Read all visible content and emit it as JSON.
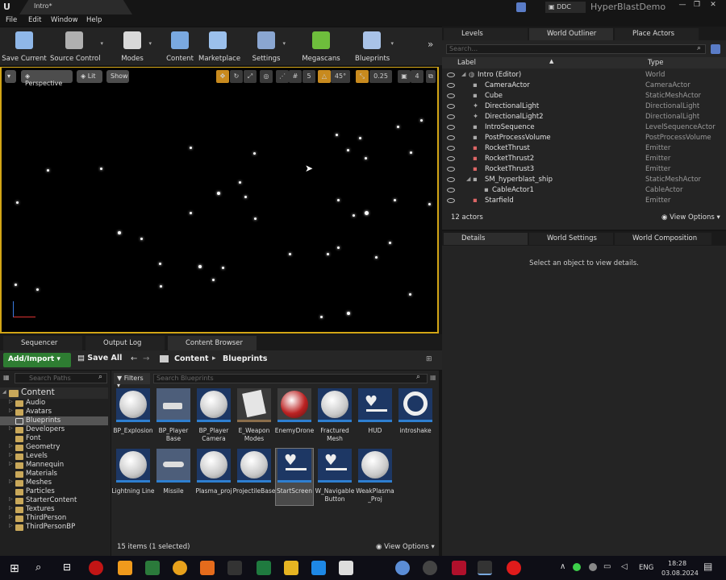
{
  "titlebar": {
    "tab": "Intro*",
    "ddc": "DDC",
    "project": "HyperBlastDemo"
  },
  "menu": [
    "File",
    "Edit",
    "Window",
    "Help"
  ],
  "toolbar": [
    {
      "label": "Save Current",
      "icon": "save-icon",
      "color": "#8fb7e8"
    },
    {
      "label": "Source Control",
      "icon": "source-control-icon",
      "color": "#b0b0b0"
    },
    {
      "label": "Modes",
      "icon": "modes-icon",
      "color": "#d9d9d9"
    },
    {
      "label": "Content",
      "icon": "content-icon",
      "color": "#7aa9e0"
    },
    {
      "label": "Marketplace",
      "icon": "marketplace-icon",
      "color": "#9bc0ec"
    },
    {
      "label": "Settings",
      "icon": "settings-icon",
      "color": "#8aa6d1"
    },
    {
      "label": "Megascans",
      "icon": "megascans-icon",
      "color": "#6ebe3c"
    },
    {
      "label": "Blueprints",
      "icon": "blueprints-icon",
      "color": "#a9c3e8"
    }
  ],
  "viewport": {
    "perspective": "Perspective",
    "lit": "Lit",
    "show": "Show",
    "grid_value": "5",
    "angle_value": "45°",
    "scale_value": "0.25",
    "speed_value": "4"
  },
  "bottom_tabs": [
    "Sequencer",
    "Output Log",
    "Content Browser"
  ],
  "content_browser": {
    "add_import": "Add/Import",
    "save_all": "Save All",
    "breadcrumb": [
      "Content",
      "Blueprints"
    ],
    "search_paths_placeholder": "Search Paths",
    "filters": "Filters",
    "search_placeholder": "Search Blueprints",
    "tree_root": "Content",
    "tree": [
      "Audio",
      "Avatars",
      "Blueprints",
      "Developers",
      "Font",
      "Geometry",
      "Levels",
      "Mannequin",
      "Materials",
      "Meshes",
      "Particles",
      "StarterContent",
      "Textures",
      "ThirdPerson",
      "ThirdPersonBP"
    ],
    "assets": [
      "BP_Explosion",
      "BP_Player Base",
      "BP_Player Camera",
      "E_Weapon Modes",
      "EnemyDrone",
      "Fractured Mesh",
      "HUD",
      "introshake",
      "Lightning Line",
      "Missile",
      "Plasma_proj",
      "ProjectileBase",
      "StartScreen",
      "W_Navigable Button",
      "WeakPlasma _Proj"
    ],
    "status": "15 items (1 selected)",
    "view_options": "View Options"
  },
  "right_tabs": [
    "Levels",
    "World Outliner",
    "Place Actors"
  ],
  "outliner": {
    "search_placeholder": "Search...",
    "col_label": "Label",
    "col_type": "Type",
    "rows": [
      {
        "label": "Intro (Editor)",
        "type": "World"
      },
      {
        "label": "CameraActor",
        "type": "CameraActor"
      },
      {
        "label": "Cube",
        "type": "StaticMeshActor"
      },
      {
        "label": "DirectionalLight",
        "type": "DirectionalLight"
      },
      {
        "label": "DirectionalLight2",
        "type": "DirectionalLight"
      },
      {
        "label": "IntroSequence",
        "type": "LevelSequenceActor"
      },
      {
        "label": "PostProcessVolume",
        "type": "PostProcessVolume"
      },
      {
        "label": "RocketThrust",
        "type": "Emitter"
      },
      {
        "label": "RocketThrust2",
        "type": "Emitter"
      },
      {
        "label": "RocketThrust3",
        "type": "Emitter"
      },
      {
        "label": "SM_hyperblast_ship",
        "type": "StaticMeshActor"
      },
      {
        "label": "CableActor1",
        "type": "CableActor"
      },
      {
        "label": "Starfield",
        "type": "Emitter"
      }
    ],
    "count": "12 actors",
    "view_options": "View Options"
  },
  "details_tabs": [
    "Details",
    "World Settings",
    "World Composition"
  ],
  "details_empty": "Select an object to view details.",
  "taskbar": {
    "lang": "ENG",
    "time": "18:28",
    "date": "03.08.2024"
  },
  "colors": {
    "accent": "#d2a516",
    "add_import": "#2e7d32",
    "asset_bg": "#1d3764"
  }
}
